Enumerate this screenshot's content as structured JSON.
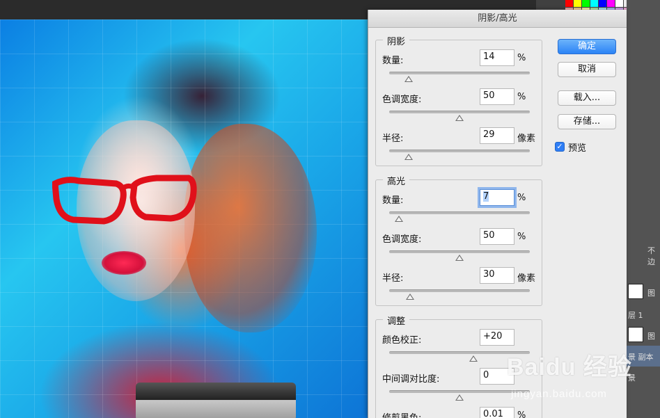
{
  "dialog": {
    "title": "阴影/高光",
    "buttons": {
      "ok": "确定",
      "cancel": "取消",
      "load": "载入...",
      "save": "存储..."
    },
    "preview": {
      "label": "预览",
      "checked": true
    }
  },
  "shadows": {
    "title": "阴影",
    "amount": {
      "label": "数量:",
      "value": "14",
      "unit": "%",
      "fraction": 0.14
    },
    "tonal_width": {
      "label": "色调宽度:",
      "value": "50",
      "unit": "%",
      "fraction": 0.5
    },
    "radius": {
      "label": "半径:",
      "value": "29",
      "unit": "像素",
      "fraction": 0.14
    }
  },
  "highlights": {
    "title": "高光",
    "amount": {
      "label": "数量:",
      "value": "7",
      "unit": "%",
      "fraction": 0.07
    },
    "tonal_width": {
      "label": "色调宽度:",
      "value": "50",
      "unit": "%",
      "fraction": 0.5
    },
    "radius": {
      "label": "半径:",
      "value": "30",
      "unit": "像素",
      "fraction": 0.15
    }
  },
  "adjustments": {
    "title": "调整",
    "color_correction": {
      "label": "颜色校正:",
      "value": "+20",
      "fraction": 0.6
    },
    "midtone_contrast": {
      "label": "中间调对比度:",
      "value": "0",
      "fraction": 0.5
    },
    "clip_black": {
      "label": "修剪黑色:",
      "value": "0.01",
      "unit": "%"
    }
  },
  "layers_panel": {
    "items": [
      "图",
      "层 1",
      "图",
      "景 副本",
      "景"
    ],
    "partial_label": "不边"
  },
  "watermark": {
    "main": "Baidu 经验",
    "sub": "jingyan.baidu.com"
  },
  "colors": {
    "accent": "#2b83f6",
    "dialog_bg": "#ececec",
    "selected_layer": "#5b6f8c"
  }
}
